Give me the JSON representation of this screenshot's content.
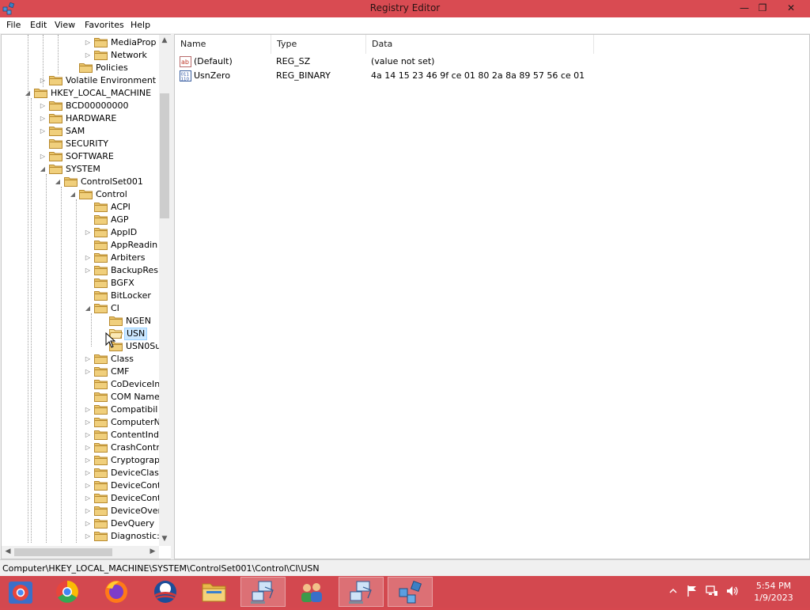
{
  "window": {
    "title": "Registry Editor",
    "controls": {
      "minimize": "—",
      "restore": "❐",
      "close": "✕"
    }
  },
  "menu": [
    "File",
    "Edit",
    "View",
    "Favorites",
    "Help"
  ],
  "tree": [
    {
      "label": "MediaProp",
      "depth": 5,
      "expander": "collapsed"
    },
    {
      "label": "Network",
      "depth": 5,
      "expander": "collapsed"
    },
    {
      "label": "Policies",
      "depth": 4,
      "expander": "none"
    },
    {
      "label": "Volatile Environment",
      "depth": 2,
      "expander": "collapsed"
    },
    {
      "label": "HKEY_LOCAL_MACHINE",
      "depth": 1,
      "expander": "expanded"
    },
    {
      "label": "BCD00000000",
      "depth": 2,
      "expander": "collapsed"
    },
    {
      "label": "HARDWARE",
      "depth": 2,
      "expander": "collapsed"
    },
    {
      "label": "SAM",
      "depth": 2,
      "expander": "collapsed"
    },
    {
      "label": "SECURITY",
      "depth": 2,
      "expander": "none"
    },
    {
      "label": "SOFTWARE",
      "depth": 2,
      "expander": "collapsed"
    },
    {
      "label": "SYSTEM",
      "depth": 2,
      "expander": "expanded"
    },
    {
      "label": "ControlSet001",
      "depth": 3,
      "expander": "expanded"
    },
    {
      "label": "Control",
      "depth": 4,
      "expander": "expanded"
    },
    {
      "label": "ACPI",
      "depth": 5,
      "expander": "none"
    },
    {
      "label": "AGP",
      "depth": 5,
      "expander": "none"
    },
    {
      "label": "AppID",
      "depth": 5,
      "expander": "collapsed"
    },
    {
      "label": "AppReadin",
      "depth": 5,
      "expander": "none"
    },
    {
      "label": "Arbiters",
      "depth": 5,
      "expander": "collapsed"
    },
    {
      "label": "BackupRes",
      "depth": 5,
      "expander": "collapsed"
    },
    {
      "label": "BGFX",
      "depth": 5,
      "expander": "none"
    },
    {
      "label": "BitLocker",
      "depth": 5,
      "expander": "none"
    },
    {
      "label": "CI",
      "depth": 5,
      "expander": "expanded"
    },
    {
      "label": "NGEN",
      "depth": 6,
      "expander": "none"
    },
    {
      "label": "USN",
      "depth": 6,
      "expander": "none",
      "selected": true
    },
    {
      "label": "USN0Su",
      "depth": 6,
      "expander": "none"
    },
    {
      "label": "Class",
      "depth": 5,
      "expander": "collapsed"
    },
    {
      "label": "CMF",
      "depth": 5,
      "expander": "collapsed"
    },
    {
      "label": "CoDeviceIn",
      "depth": 5,
      "expander": "none"
    },
    {
      "label": "COM Name",
      "depth": 5,
      "expander": "none"
    },
    {
      "label": "Compatibil",
      "depth": 5,
      "expander": "collapsed"
    },
    {
      "label": "ComputerN",
      "depth": 5,
      "expander": "collapsed"
    },
    {
      "label": "ContentInd",
      "depth": 5,
      "expander": "collapsed"
    },
    {
      "label": "CrashContr",
      "depth": 5,
      "expander": "collapsed"
    },
    {
      "label": "Cryptograpl",
      "depth": 5,
      "expander": "collapsed"
    },
    {
      "label": "DeviceClas",
      "depth": 5,
      "expander": "collapsed"
    },
    {
      "label": "DeviceCont",
      "depth": 5,
      "expander": "collapsed"
    },
    {
      "label": "DeviceCont",
      "depth": 5,
      "expander": "collapsed"
    },
    {
      "label": "DeviceOver",
      "depth": 5,
      "expander": "collapsed"
    },
    {
      "label": "DevQuery",
      "depth": 5,
      "expander": "collapsed"
    },
    {
      "label": "Diagnostic:",
      "depth": 5,
      "expander": "collapsed"
    }
  ],
  "columns": {
    "name": "Name",
    "type": "Type",
    "data": "Data"
  },
  "values": [
    {
      "icon": "string-value-icon",
      "name": "(Default)",
      "type": "REG_SZ",
      "data": "(value not set)"
    },
    {
      "icon": "binary-value-icon",
      "name": "UsnZero",
      "type": "REG_BINARY",
      "data": "4a 14 15 23 46 9f ce 01 80 2a 8a 89 57 56 ce 01"
    }
  ],
  "status": {
    "path": "Computer\\HKEY_LOCAL_MACHINE\\SYSTEM\\ControlSet001\\Control\\CI\\USN"
  },
  "taskbar": {
    "items": [
      {
        "name": "chrome-app-icon",
        "active": false
      },
      {
        "name": "chrome-icon",
        "active": false
      },
      {
        "name": "firefox-icon",
        "active": false
      },
      {
        "name": "obama-logo-icon",
        "active": false
      },
      {
        "name": "file-explorer-icon",
        "active": false
      },
      {
        "name": "network-computers-icon",
        "active": true
      },
      {
        "name": "users-icon",
        "active": false
      },
      {
        "name": "network-computers-icon",
        "active": true
      },
      {
        "name": "registry-editor-icon",
        "active": true
      }
    ],
    "clock": {
      "time": "5:54 PM",
      "date": "1/9/2023"
    }
  },
  "colors": {
    "accent": "#d94b52",
    "selection": "#cce8ff",
    "folder": "#e9c46a"
  }
}
